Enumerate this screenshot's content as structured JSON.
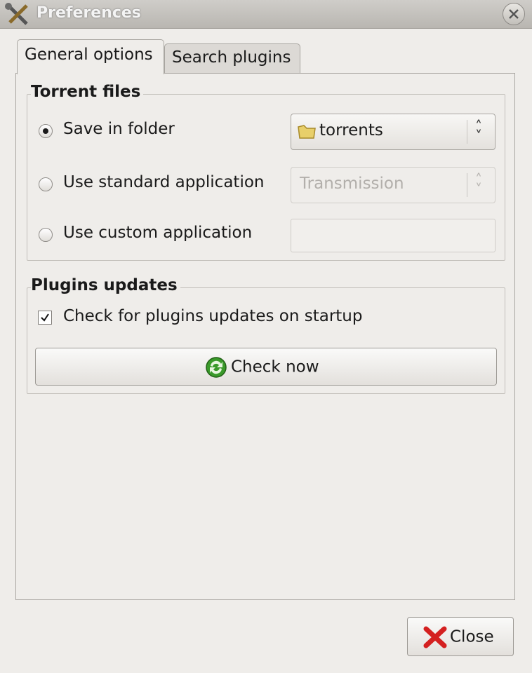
{
  "window": {
    "title": "Preferences",
    "title_icon": "wrench-screwdriver-icon",
    "close_icon": "close-icon"
  },
  "tabs": [
    {
      "label": "General options",
      "active": true
    },
    {
      "label": "Search plugins",
      "active": false
    }
  ],
  "torrent_files": {
    "heading": "Torrent files",
    "options": [
      {
        "label": "Save in folder",
        "selected": true,
        "control": "folder chooser",
        "value": "torrents",
        "icon": "folder-icon"
      },
      {
        "label": "Use standard application",
        "selected": false,
        "control": "combo",
        "value": "Transmission",
        "enabled": false
      },
      {
        "label": "Use custom application",
        "selected": false,
        "control": "entry",
        "value": "",
        "enabled": false
      }
    ]
  },
  "plugins_updates": {
    "heading": "Plugins updates",
    "check_label": "Check for plugins updates on startup",
    "checked": true,
    "check_now_label": "Check now",
    "check_now_icon": "refresh-icon"
  },
  "footer": {
    "close_label": "Close",
    "close_icon": "red-x-icon"
  },
  "colors": {
    "window_bg": "#efedea",
    "title_bar": "#c4c1bc",
    "close_x": "#d42020",
    "refresh_green": "#3a9a2a"
  }
}
